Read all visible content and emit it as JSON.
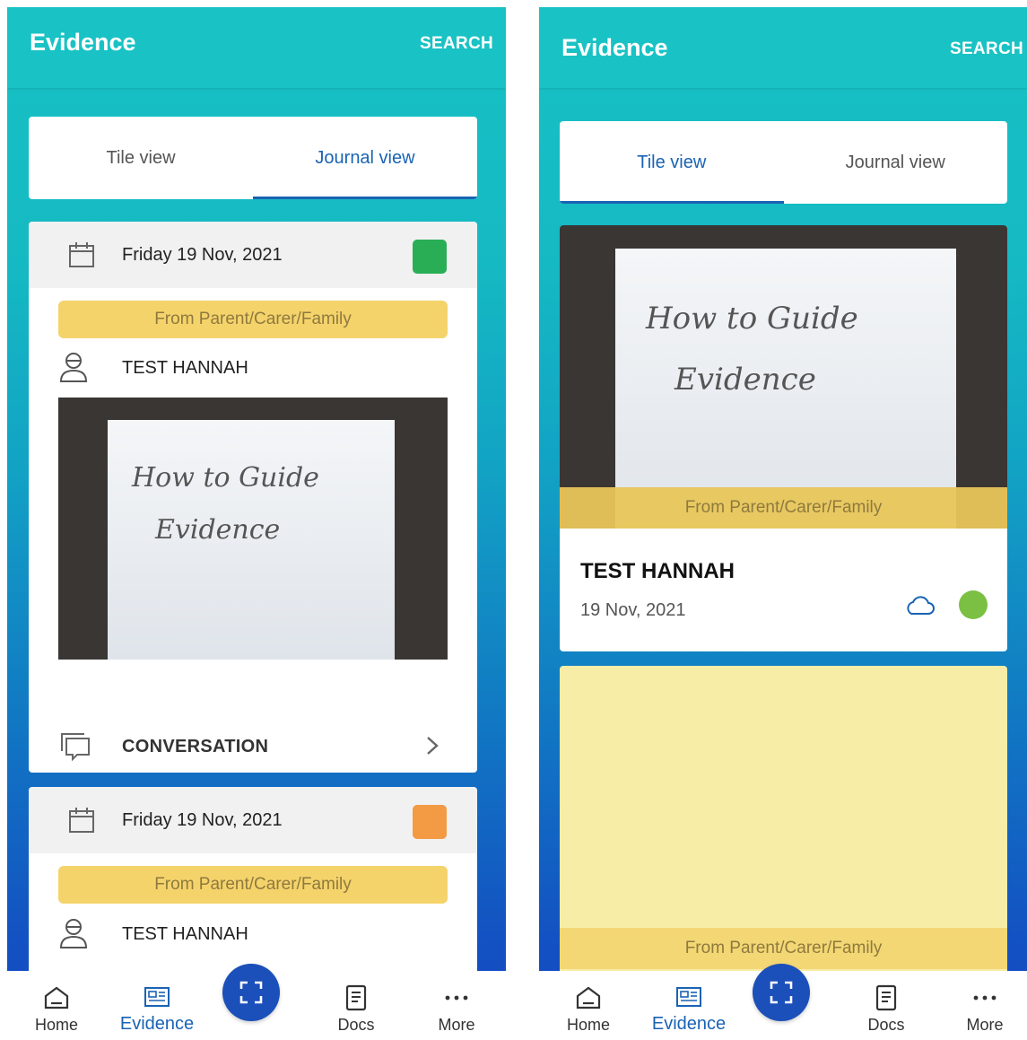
{
  "left": {
    "appbar": {
      "title": "Evidence",
      "search": "SEARCH"
    },
    "tabs": {
      "tile": "Tile view",
      "journal": "Journal view"
    },
    "entries": [
      {
        "date": "Friday 19 Nov, 2021",
        "status_color": "#2aae55",
        "source": "From Parent/Carer/Family",
        "person": "TEST HANNAH",
        "photo_text": [
          "How to Guide",
          "Evidence"
        ],
        "conversation": "CONVERSATION"
      },
      {
        "date": "Friday 19 Nov, 2021",
        "status_color": "#f39a44",
        "source": "From Parent/Carer/Family",
        "person": "TEST HANNAH"
      }
    ]
  },
  "right": {
    "appbar": {
      "title": "Evidence",
      "search": "SEARCH"
    },
    "tabs": {
      "tile": "Tile view",
      "journal": "Journal view"
    },
    "tiles": [
      {
        "source": "From Parent/Carer/Family",
        "person": "TEST HANNAH",
        "date": "19 Nov, 2021",
        "status_color": "#7bc043",
        "photo_text": [
          "How to Guide",
          "Evidence"
        ]
      },
      {
        "source": "From Parent/Carer/Family",
        "background": "#f8eda6"
      }
    ]
  },
  "nav": {
    "home": "Home",
    "evidence": "Evidence",
    "docs": "Docs",
    "more": "More"
  },
  "colors": {
    "accent": "#1a63b4",
    "teal": "#19c2c4",
    "fab": "#1b4fb9"
  }
}
